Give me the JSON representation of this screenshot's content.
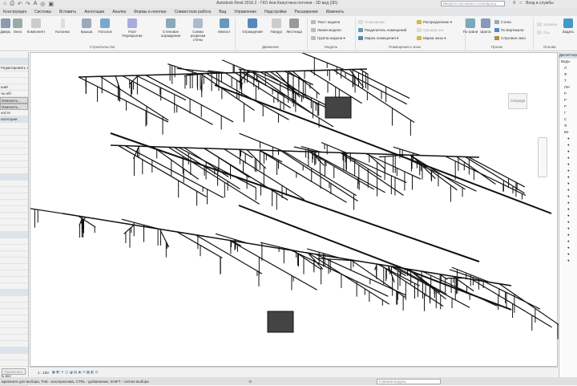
{
  "title": "Autodesk Revit 2016.2 -   ГКО Ани Капустина потолки - 3D вид {3D}",
  "search_placeholder": "Введите ключевое слово/фразу",
  "signin": "Вход в службы",
  "tabs": [
    "Конструкция",
    "Системы",
    "Вставить",
    "Аннотации",
    "Анализ",
    "Формы и генплан",
    "Совместная работа",
    "Вид",
    "Управление",
    "Надстройки",
    "Расширения",
    "Изменить"
  ],
  "tools": {
    "door": "Дверь",
    "window": "Окно",
    "component": "Компонент",
    "column": "Колонна",
    "roof": "Крыша",
    "ceiling": "Потолок",
    "floor": "Пол/Перекрытие",
    "curtain_system": "Стеновое ограждение",
    "curtain_grid": "Схема разрезки стены",
    "mullion": "Импост",
    "railing": "Ограждение",
    "ramp": "Пандус",
    "stair": "Лестница",
    "model_text": "Текст модели",
    "model_line": "Линия модели",
    "model_group": "Группа модели",
    "room": "Помещение",
    "room_separator": "Разделитель помещений",
    "room_tag": "Марка помещения",
    "area": "Распределение",
    "area_boundary": "Граница зон",
    "area_tag": "Марка зоны",
    "by_face": "По грани",
    "shaft": "Шахта",
    "wall": "Стена",
    "vertical": "По вертикали",
    "dormer": "Слуховое окно",
    "level": "Уровень",
    "grid": "Ось",
    "set": "Задать"
  },
  "panels": {
    "build": "Строительство",
    "circulation": "Движение",
    "model": "Модель",
    "room_area": "Помещения и зоны",
    "opening": "Проем",
    "datum": "Основа"
  },
  "properties": {
    "rows": [
      "",
      "",
      "Редактировать тип",
      "",
      "",
      "ший",
      "ты и/б",
      "Изменить...",
      "Изменить...",
      "ности",
      "категории",
      "",
      "",
      "",
      "",
      "",
      "",
      "",
      "",
      "",
      "",
      "",
      "",
      "",
      "",
      "",
      "",
      "",
      "",
      "",
      "",
      "",
      "",
      "",
      "",
      "",
      "",
      "",
      "",
      "",
      "",
      "",
      "",
      "",
      "",
      "",
      "",
      "",
      "",
      "",
      "ть все",
      "стимые/фрукт..."
    ],
    "apply": "Применить"
  },
  "view_cube_label": "Спереди",
  "browser": {
    "header": "Диспетчер проекта",
    "items": [
      "Виды",
      "Л",
      "Ф",
      "Т",
      "Лег",
      "Р",
      "Р",
      "Р",
      "Г",
      "С",
      "Я",
      "Ве"
    ]
  },
  "viewbar": {
    "scale": "1 : 100"
  },
  "status": {
    "hint": "Щелкните для выбора, TAB - альтернатива, CTRL - добавление, SHIFT - снятие выбора",
    "ws": "Главная модель",
    "zero": ":0"
  }
}
